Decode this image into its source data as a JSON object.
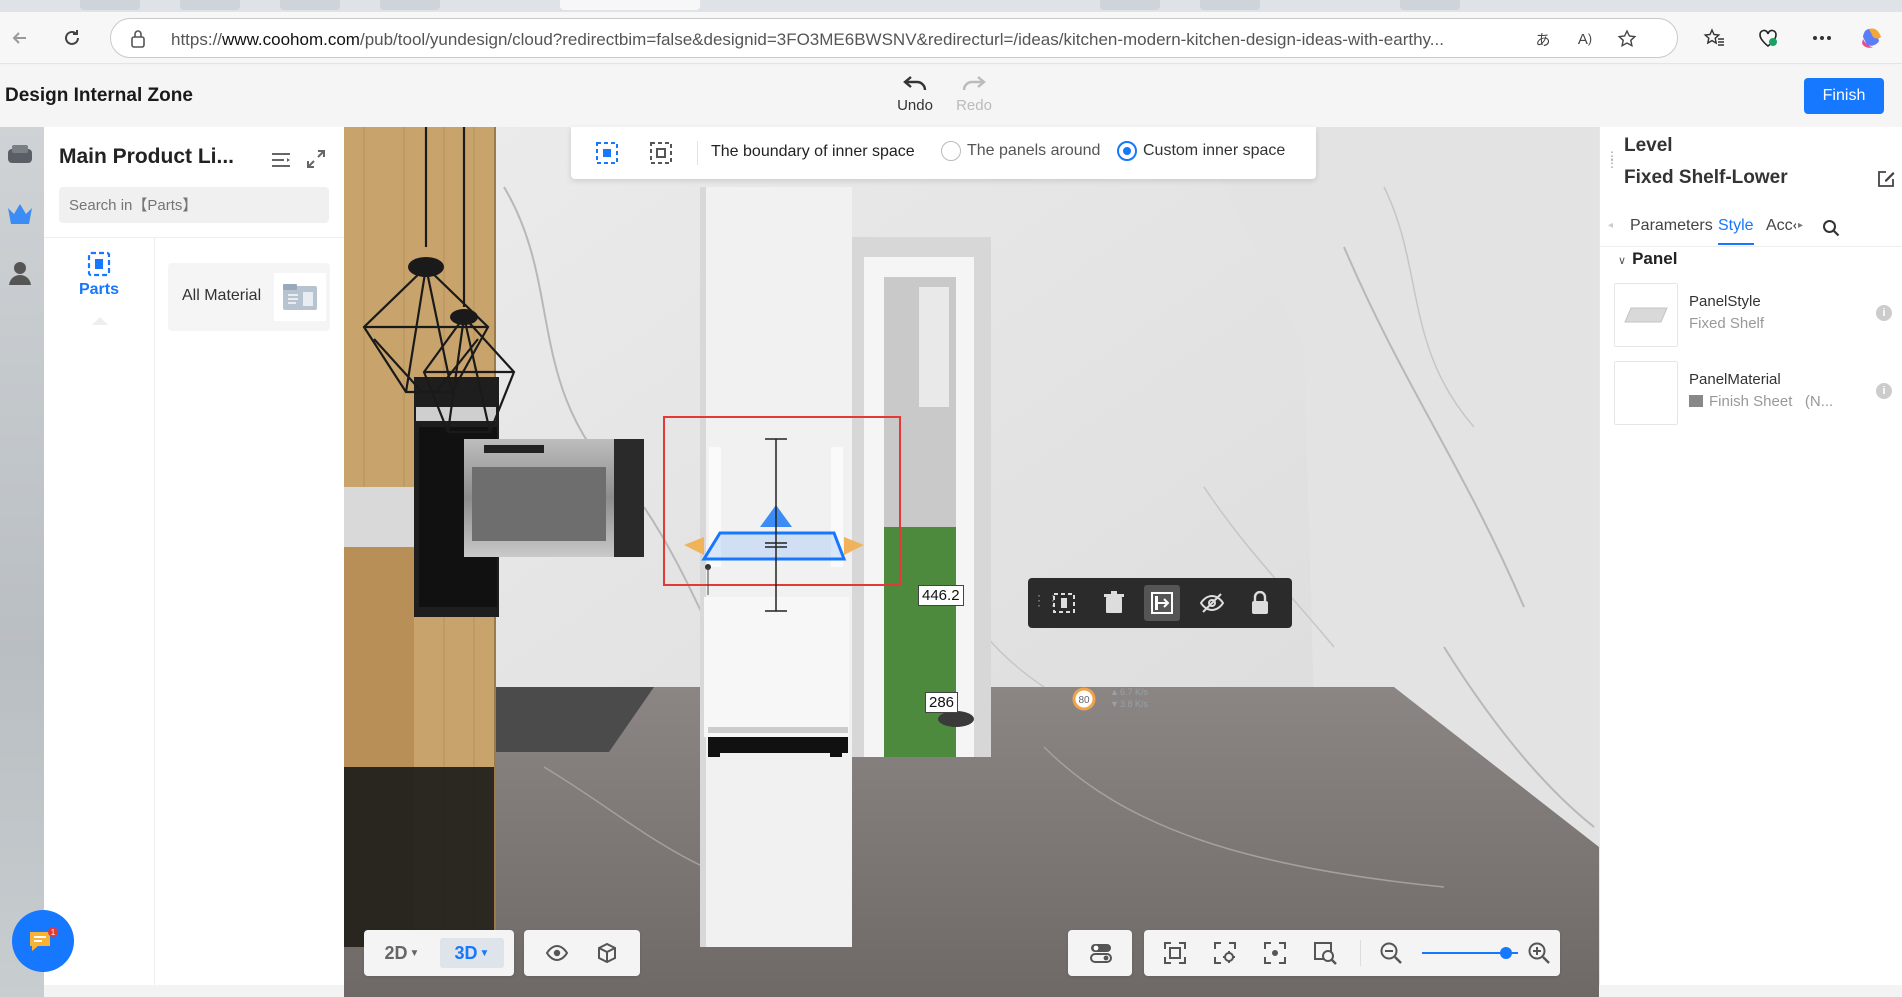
{
  "browser": {
    "url_prefix": "https://",
    "url_domain": "www.coohom.com",
    "url_rest": "/pub/tool/yundesign/cloud?redirectbim=false&designid=3FO3ME6BWSNV&redirecturl=/ideas/kitchen-modern-kitchen-design-ideas-with-earthy..."
  },
  "app": {
    "zone_title": "Design Internal Zone",
    "undo_label": "Undo",
    "redo_label": "Redo",
    "finish_label": "Finish"
  },
  "left_panel": {
    "title": "Main Product Li...",
    "search_placeholder": "Search in【Parts】",
    "tab_label": "Parts",
    "category_label": "All Material"
  },
  "boundary_bar": {
    "label": "The boundary of inner space",
    "options": [
      "The panels around",
      "Custom inner space"
    ],
    "selected": "Custom inner space"
  },
  "dimensions": {
    "upper": "446.2",
    "lower": "286"
  },
  "view": {
    "mode_2d": "2D",
    "mode_3d": "3D",
    "active_mode": "3D",
    "zoom_level": 0.88
  },
  "right_panel": {
    "level_label": "Level",
    "item_name": "Fixed Shelf-Lower",
    "tabs": [
      "Parameters",
      "Style",
      "Acc‹"
    ],
    "active_tab": "Style",
    "section": "Panel",
    "props": [
      {
        "name": "PanelStyle",
        "value": "Fixed Shelf"
      },
      {
        "name": "PanelMaterial",
        "value": "Finish Sheet   (N..."
      }
    ]
  },
  "stats": {
    "fps": "80",
    "up": "6.7 K/s",
    "down": "3.8 K/s"
  },
  "colors": {
    "accent": "#1677ff",
    "selection_box": "#e53935",
    "toolbar_dark": "#2b2b2b"
  }
}
